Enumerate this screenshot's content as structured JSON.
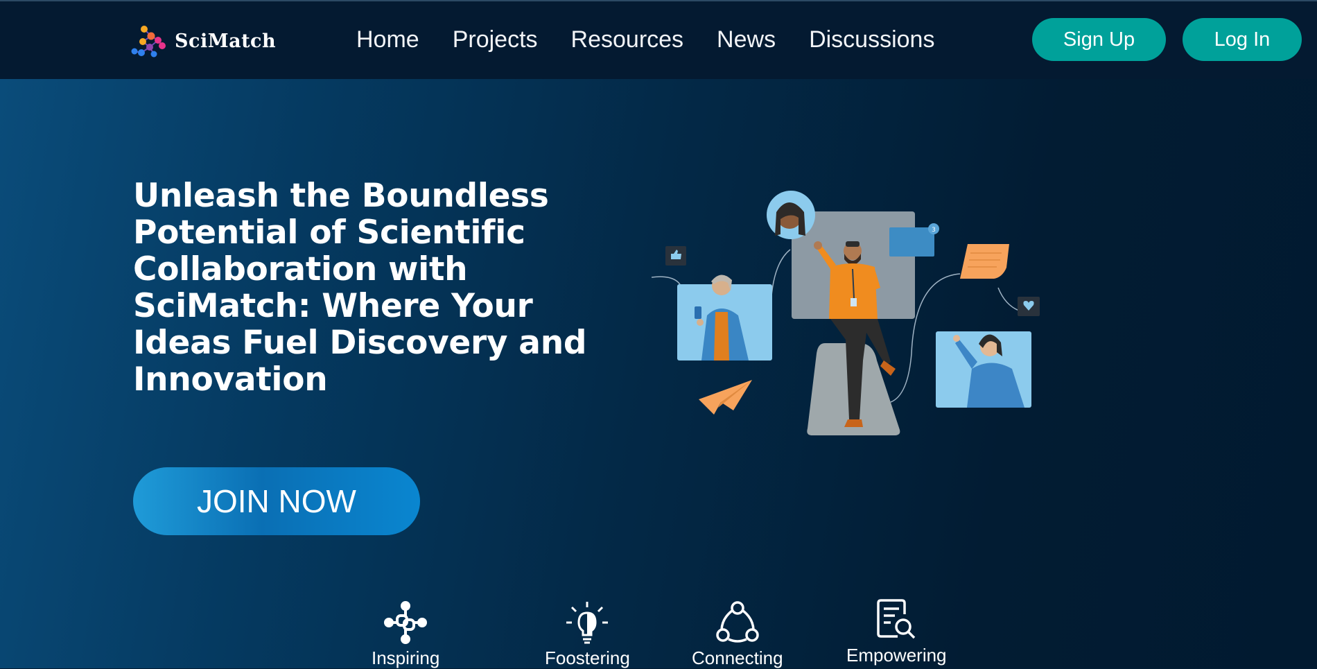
{
  "brand": {
    "name": "SciMatch",
    "logo_icon": "molecule-network-icon"
  },
  "nav": {
    "links": [
      {
        "label": "Home"
      },
      {
        "label": "Projects"
      },
      {
        "label": "Resources"
      },
      {
        "label": "News"
      },
      {
        "label": "Discussions"
      }
    ],
    "signup_label": "Sign Up",
    "login_label": "Log In"
  },
  "hero": {
    "headline": "Unleash the Boundless Potential of Scientific Collaboration with SciMatch: Where Your Ideas Fuel Discovery and Innovation",
    "cta_label": "JOIN NOW",
    "illustration": "team-collaboration-illustration",
    "notification_count": "3"
  },
  "features": [
    {
      "label": "Inspiring",
      "icon": "interlinked-network-icon"
    },
    {
      "label": "Foostering",
      "icon": "lightbulb-icon"
    },
    {
      "label": "Connecting",
      "icon": "connected-nodes-icon"
    },
    {
      "label": "Empowering",
      "icon": "document-search-icon"
    }
  ],
  "colors": {
    "nav_bg": "#041a31",
    "accent_teal": "#00a19a",
    "cta_blue": "#0a86d0",
    "hero_bg": "#021c33"
  }
}
